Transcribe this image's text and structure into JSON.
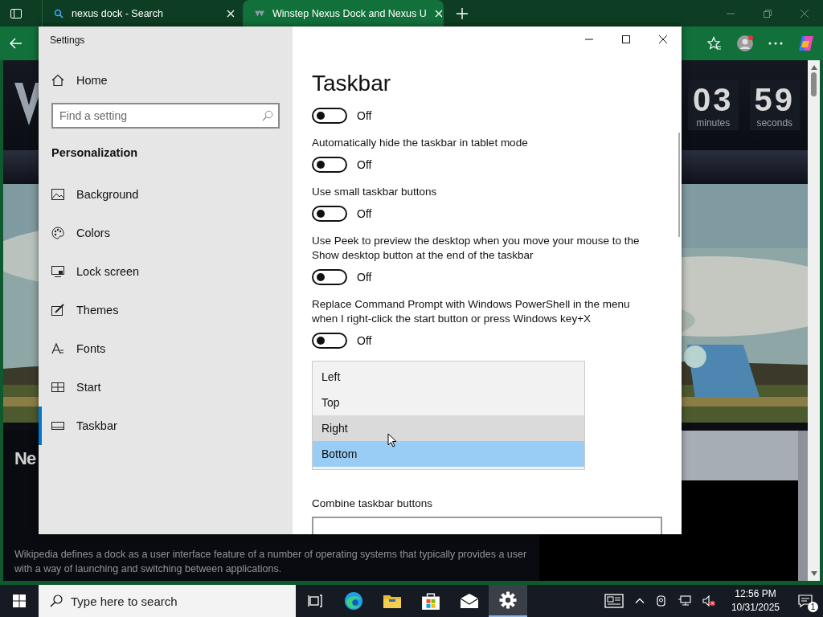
{
  "browser": {
    "tabs": [
      {
        "title": "nexus dock - Search",
        "kind": "search",
        "selected": false
      },
      {
        "title": "Winstep Nexus Dock and Nexus U",
        "kind": "site",
        "selected": true
      }
    ]
  },
  "webpage": {
    "countdown": [
      {
        "value": "03",
        "label": "minutes"
      },
      {
        "value": "59",
        "label": "seconds"
      }
    ],
    "logo_text": "Ne",
    "description": "Wikipedia defines a dock as a user interface feature of a number of operating systems that typically provides a user with a way of launching and switching between applications."
  },
  "settings": {
    "title": "Settings",
    "home": "Home",
    "search": {
      "placeholder": "Find a setting"
    },
    "section": "Personalization",
    "nav": [
      {
        "label": "Background",
        "kind": "picture",
        "selected": false
      },
      {
        "label": "Colors",
        "kind": "palette",
        "selected": false
      },
      {
        "label": "Lock screen",
        "kind": "monitor",
        "selected": false
      },
      {
        "label": "Themes",
        "kind": "brush",
        "selected": false
      },
      {
        "label": "Fonts",
        "kind": "font",
        "selected": false
      },
      {
        "label": "Start",
        "kind": "grid",
        "selected": false
      },
      {
        "label": "Taskbar",
        "kind": "taskbar",
        "selected": true
      }
    ],
    "page_title": "Taskbar",
    "toggles": [
      {
        "on": false,
        "state": "Off"
      },
      {
        "label": "Automatically hide the taskbar in tablet mode",
        "on": false,
        "state": "Off"
      },
      {
        "label": "Use small taskbar buttons",
        "on": false,
        "state": "Off"
      },
      {
        "label": "Use Peek to preview the desktop when you move your mouse to the Show desktop button at the end of the taskbar",
        "on": false,
        "state": "Off"
      },
      {
        "label": "Replace Command Prompt with Windows PowerShell in the menu when I right-click the start button or press Windows key+X",
        "on": false,
        "state": "Off"
      }
    ],
    "dropdown": {
      "options": [
        {
          "label": "Left",
          "hovered": false,
          "selected": false
        },
        {
          "label": "Top",
          "hovered": false,
          "selected": false
        },
        {
          "label": "Right",
          "hovered": true,
          "selected": false
        },
        {
          "label": "Bottom",
          "hovered": false,
          "selected": true
        }
      ]
    },
    "combine_label": "Combine taskbar buttons"
  },
  "taskbar": {
    "search_placeholder": "Type here to search",
    "apps": [
      {
        "kind": "taskview",
        "active": false
      },
      {
        "kind": "edge",
        "active": false
      },
      {
        "kind": "folder",
        "active": false
      },
      {
        "kind": "store",
        "active": false
      },
      {
        "kind": "mail",
        "active": false
      },
      {
        "kind": "gear",
        "active": true
      }
    ],
    "time": "12:56 PM",
    "date": "10/31/2025",
    "notifications": "1"
  }
}
